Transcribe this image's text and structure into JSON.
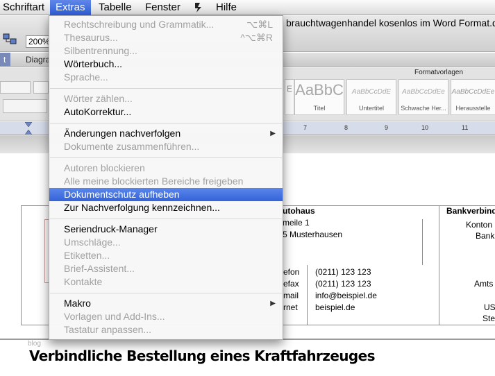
{
  "menubar": {
    "items": [
      "Schriftart",
      "Extras",
      "Tabelle",
      "Fenster",
      "script-icon",
      "Hilfe"
    ]
  },
  "toolbar": {
    "zoom": "200%",
    "doc_title": "brauchtwagenhandel kosenlos im Word Format.doc"
  },
  "ribbon_tabs": [
    "t",
    "Diagra"
  ],
  "ribbon": {
    "styles_label": "Formatvorlagen",
    "styles": [
      {
        "preview": "AaBbC",
        "name": "Titel"
      },
      {
        "preview": "AaBbCcDdE",
        "name": "Untertitel"
      },
      {
        "preview": "AaBbCcDdEe",
        "name": "Schwache Her..."
      },
      {
        "preview": "AaBbCcDdEe",
        "name": "Herausstelle"
      }
    ],
    "ruler_numbers": [
      "7",
      "8",
      "9",
      "10",
      "11"
    ]
  },
  "menu": {
    "items": [
      {
        "label": "Rechtschreibung und Grammatik...",
        "shortcut": "⌥⌘L",
        "enabled": false
      },
      {
        "label": "Thesaurus...",
        "shortcut": "^⌥⌘R",
        "enabled": false
      },
      {
        "label": "Silbentrennung...",
        "enabled": false
      },
      {
        "label": "Wörterbuch...",
        "enabled": true
      },
      {
        "label": "Sprache...",
        "enabled": false
      },
      {
        "label": "Wörter zählen...",
        "enabled": false
      },
      {
        "label": "AutoKorrektur...",
        "enabled": true
      },
      {
        "label": "Änderungen nachverfolgen",
        "enabled": true,
        "submenu": true
      },
      {
        "label": "Dokumente zusammenführen...",
        "enabled": false
      },
      {
        "label": "Autoren blockieren",
        "enabled": false
      },
      {
        "label": "Alle meine blockierten Bereiche freigeben",
        "enabled": false
      },
      {
        "label": "Dokumentschutz aufheben",
        "enabled": true,
        "highlighted": true
      },
      {
        "label": "Zur Nachverfolgung kennzeichnen...",
        "enabled": true
      },
      {
        "label": "Seriendruck-Manager",
        "enabled": true
      },
      {
        "label": "Umschläge...",
        "enabled": false
      },
      {
        "label": "Etiketten...",
        "enabled": false
      },
      {
        "label": "Brief-Assistent...",
        "enabled": false
      },
      {
        "label": "Kontakte",
        "enabled": false
      },
      {
        "label": "Makro",
        "enabled": true,
        "submenu": true
      },
      {
        "label": "Vorlagen und Add-Ins...",
        "enabled": false
      },
      {
        "label": "Tastatur anpassen...",
        "enabled": false
      }
    ]
  },
  "document": {
    "col1": {
      "heading": "utohaus",
      "line1": "meile 1",
      "line2": "5 Musterhausen"
    },
    "contact_labels": [
      "efon",
      "efax",
      "mail",
      "rnet"
    ],
    "contact_values": [
      "(0211) 123 123",
      "(0211) 123 123",
      "info@beispiel.de",
      "beispiel.de"
    ],
    "col3": {
      "heading": "Bankverbind",
      "lines": [
        "Konton",
        "Bank",
        "Amts",
        "US",
        "Ste"
      ]
    },
    "watermark": "blog",
    "heading": "Verbindliche Bestellung eines Kraftfahrzeuges"
  },
  "colors": {
    "menu_highlight": "#3463d9",
    "disabled_text": "#a0a0a0"
  }
}
